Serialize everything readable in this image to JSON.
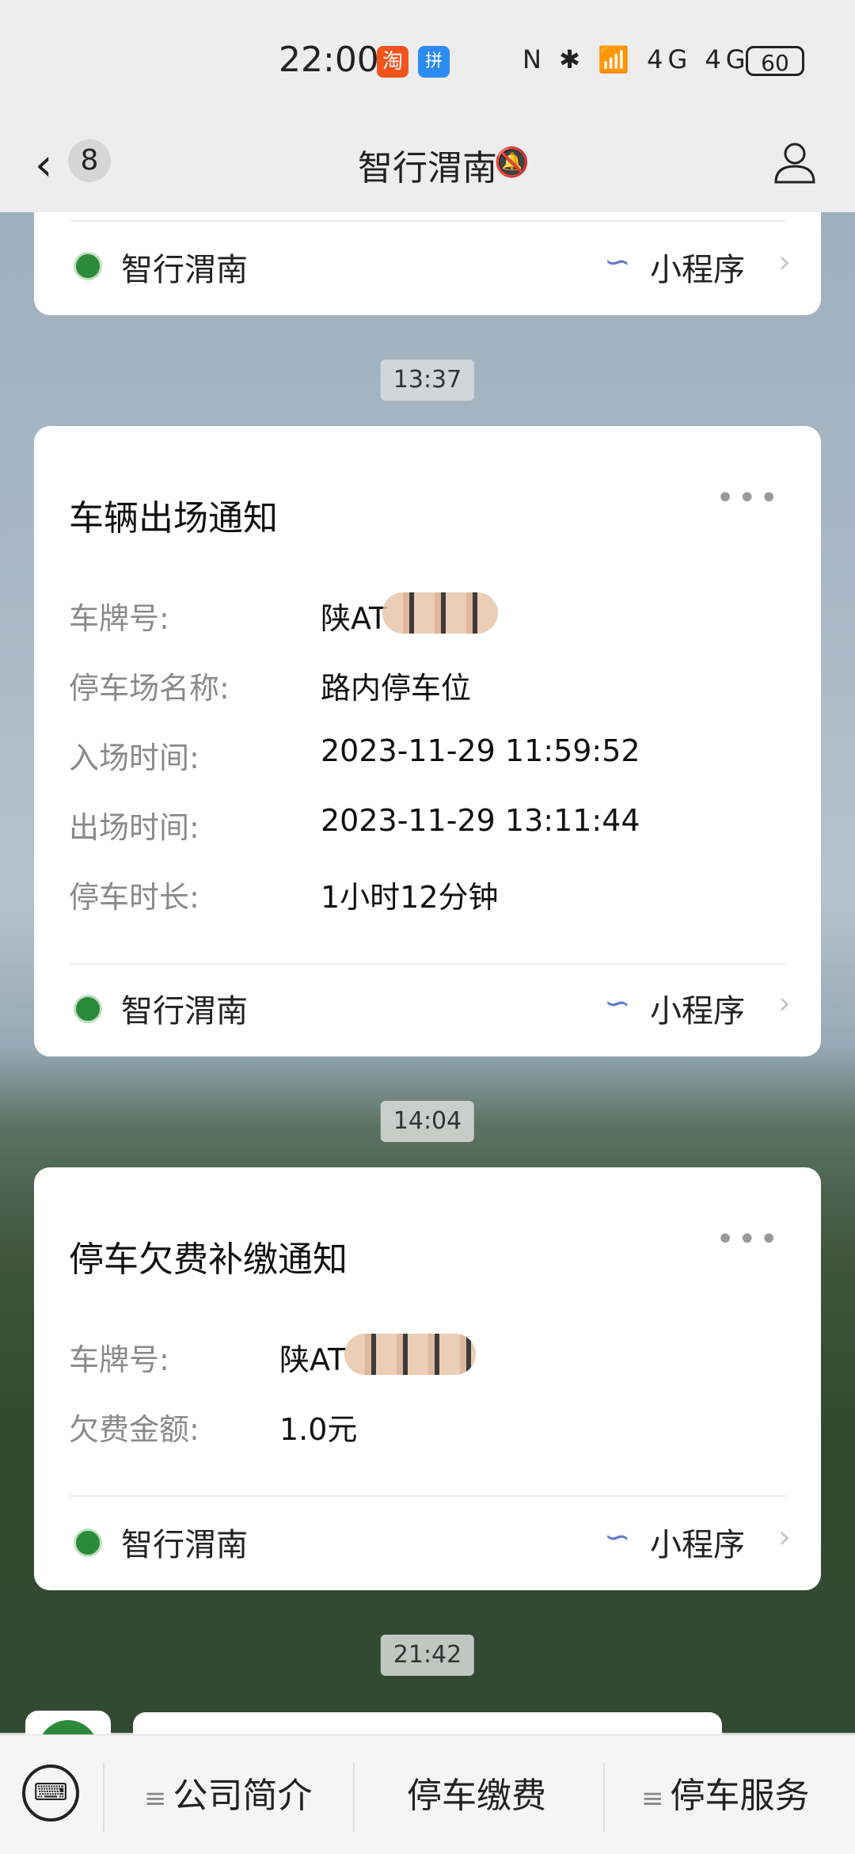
{
  "status_bar": {
    "time": "22:00",
    "app1": "淘",
    "app2": "拼",
    "icons": "N ✱ 📶 4G 4G",
    "battery": "60"
  },
  "nav": {
    "back_count": "8",
    "title": "智行渭南"
  },
  "cards": [
    {
      "footer": {
        "name": "智行渭南",
        "mini_program": "小程序"
      }
    },
    {
      "title": "车辆出场通知",
      "rows": [
        {
          "label": "车牌号:",
          "value": "陕AT"
        },
        {
          "label": "停车场名称:",
          "value": "路内停车位"
        },
        {
          "label": "入场时间:",
          "value": "2023-11-29 11:59:52"
        },
        {
          "label": "出场时间:",
          "value": "2023-11-29 13:11:44"
        },
        {
          "label": "停车时长:",
          "value": "1小时12分钟"
        }
      ],
      "footer": {
        "name": "智行渭南",
        "mini_program": "小程序"
      }
    },
    {
      "title": "停车欠费补缴通知",
      "rows": [
        {
          "label": "车牌号:",
          "value": "陕AT"
        },
        {
          "label": "欠费金额:",
          "value": "1.0元"
        }
      ],
      "footer": {
        "name": "智行渭南",
        "mini_program": "小程序"
      }
    }
  ],
  "timestamps": [
    "13:37",
    "14:04",
    "21:42"
  ],
  "bottom_menu": [
    "公司简介",
    "停车缴费",
    "停车服务"
  ],
  "colors": {
    "accent": "#5b7bd4",
    "logo_green": "#2d8a3a"
  },
  "icons": {
    "back": "chevron-left-icon",
    "bell": "bell-muted-icon",
    "profile": "person-icon",
    "more": "more-dots-icon",
    "mini": "link-icon",
    "keyboard": "keyboard-icon"
  }
}
